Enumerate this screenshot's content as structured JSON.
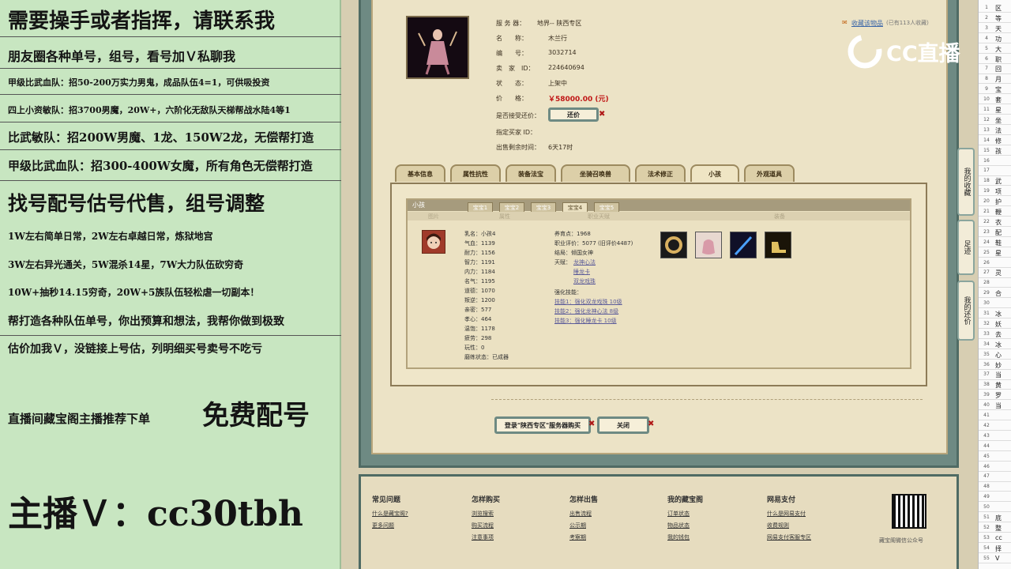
{
  "stream_overlay": {
    "lines": [
      "需要操手或者指挥，请联系我",
      "朋友圈各种单号，组号，看号加Ｖ私聊我",
      "甲级比武血队：招50-200万实力男鬼，成品队伍4=1，可供吸投资",
      "四上小资敏队：招3700男魔，20W+，六阶化无敌队天梯帮战水陆4等1",
      "比武敏队：招200W男魔、1龙、150W2龙，无偿帮打造",
      "甲级比武血队：招300-400W女魔，所有角色无偿帮打造",
      "找号配号估号代售，组号调整",
      "1W左右简单日常，2W左右卓越日常，炼狱地宫",
      "3W左右异光通关，5W混杀14星，7W大力队伍砍穷奇",
      "10W+抽秒14.15穷奇，20W+5族队伍轻松虐一切副本！",
      "帮打造各种队伍单号，你出预算和想法，我帮你做到极致",
      "估价加我Ｖ，没链接上号估，列明细买号卖号不吃亏",
      "直播间藏宝阁主播推荐下单",
      "免费配号",
      "主播Ｖ：cc30tbh"
    ],
    "brand": "CC直播"
  },
  "listing": {
    "server_label": "服 务 器：",
    "server_value": "地界-- 陕西专区",
    "name_label": "名　　称：",
    "name_value": "木兰行",
    "id_label": "编　　号：",
    "id_value": "3032714",
    "seller_label": "卖　家　ID：",
    "seller_value": "224640694",
    "status_label": "状　　态：",
    "status_value": "上架中",
    "price_label": "价　　格：",
    "price_value": "￥58000.00 (元)",
    "counter_label": "是否接受还价：",
    "counter_button": "还价",
    "buyer_label": "指定买家 ID：",
    "remaining_label": "出售剩余时间：",
    "remaining_value": "6天17时",
    "fav_link": "收藏该物品",
    "fav_count": "(已有113人收藏)"
  },
  "tabs": [
    "基本信息",
    "属性抗性",
    "装备法宝",
    "坐骑召唤兽",
    "法术修正",
    "小孩",
    "外观道具"
  ],
  "child_panel": {
    "header": "小孩",
    "subtabs": [
      "宝宝1",
      "宝宝2",
      "宝宝3",
      "宝宝4",
      "宝宝5"
    ],
    "col_headers": [
      "图片",
      "属性",
      "职业天赋",
      "装备"
    ],
    "attrs": [
      "乳名：小孩4",
      "气血：1139",
      "耐力：1156",
      "智力：1191",
      "内力：1184",
      "名气：1195",
      "道德：1070",
      "叛逆：1200",
      "亲密：577",
      "孝心：464",
      "温饱：1178",
      "疲劳：298",
      "玩性：0",
      "磨练状态：已成器"
    ],
    "career": [
      "养育点：1968",
      "职业评价：5077 (旧评价4487)",
      "结局：倾国女神",
      "天赋："
    ],
    "talents": [
      "龙神心法",
      "睡龙卡",
      "双龙戏珠"
    ],
    "skill_title": "强化技能：",
    "skills": [
      "技能1：强化双龙戏珠 10级",
      "技能2：强化龙神心法 8级",
      "技能3：强化睡龙卡 10级"
    ]
  },
  "actions": {
    "buy": "登录\"陕西专区\"服务器购买",
    "close": "关闭"
  },
  "side_buttons": [
    "我的收藏",
    "足迹",
    "我的还价"
  ],
  "footer": {
    "cols": [
      {
        "title": "常见问题",
        "links": [
          "什么是藏宝阁?",
          "更多问题"
        ]
      },
      {
        "title": "怎样购买",
        "links": [
          "浏览搜索",
          "购买流程",
          "注意事项"
        ]
      },
      {
        "title": "怎样出售",
        "links": [
          "出售流程",
          "公示期",
          "考察期"
        ]
      },
      {
        "title": "我的藏宝阁",
        "links": [
          "订单状态",
          "物品状态",
          "我的钱包"
        ]
      },
      {
        "title": "网易支付",
        "links": [
          "什么是网易支付",
          "收费规则",
          "网易支付客服专区"
        ]
      }
    ],
    "qr_caption": "藏宝阁微信公众号"
  },
  "sheet": {
    "rows": [
      {
        "n": "1",
        "t": "区"
      },
      {
        "n": "2",
        "t": "等"
      },
      {
        "n": "3",
        "t": "天"
      },
      {
        "n": "4",
        "t": "功"
      },
      {
        "n": "5",
        "t": "大"
      },
      {
        "n": "6",
        "t": "职"
      },
      {
        "n": "7",
        "t": "回"
      },
      {
        "n": "8",
        "t": "月"
      },
      {
        "n": "9",
        "t": "宝"
      },
      {
        "n": "10",
        "t": "套"
      },
      {
        "n": "11",
        "t": "星"
      },
      {
        "n": "12",
        "t": "坐"
      },
      {
        "n": "13",
        "t": "法"
      },
      {
        "n": "14",
        "t": "修"
      },
      {
        "n": "15",
        "t": "孩"
      },
      {
        "n": "16",
        "t": ""
      },
      {
        "n": "17",
        "t": ""
      },
      {
        "n": "18",
        "t": "武"
      },
      {
        "n": "19",
        "t": "项"
      },
      {
        "n": "20",
        "t": "护"
      },
      {
        "n": "21",
        "t": "鞭"
      },
      {
        "n": "22",
        "t": "衣"
      },
      {
        "n": "23",
        "t": "配"
      },
      {
        "n": "24",
        "t": "鞋"
      },
      {
        "n": "25",
        "t": "星"
      },
      {
        "n": "26",
        "t": ""
      },
      {
        "n": "27",
        "t": "灵"
      },
      {
        "n": "28",
        "t": ""
      },
      {
        "n": "29",
        "t": "合"
      },
      {
        "n": "30",
        "t": ""
      },
      {
        "n": "31",
        "t": "冰"
      },
      {
        "n": "32",
        "t": "妖"
      },
      {
        "n": "33",
        "t": "去"
      },
      {
        "n": "34",
        "t": "冰"
      },
      {
        "n": "35",
        "t": "心"
      },
      {
        "n": "36",
        "t": "妙"
      },
      {
        "n": "37",
        "t": "当"
      },
      {
        "n": "38",
        "t": "黄"
      },
      {
        "n": "39",
        "t": "罗"
      },
      {
        "n": "40",
        "t": "当"
      },
      {
        "n": "41",
        "t": ""
      },
      {
        "n": "42",
        "t": ""
      },
      {
        "n": "43",
        "t": ""
      },
      {
        "n": "44",
        "t": ""
      },
      {
        "n": "45",
        "t": ""
      },
      {
        "n": "46",
        "t": ""
      },
      {
        "n": "47",
        "t": ""
      },
      {
        "n": "48",
        "t": ""
      },
      {
        "n": "49",
        "t": ""
      },
      {
        "n": "50",
        "t": ""
      },
      {
        "n": "51",
        "t": "底"
      },
      {
        "n": "52",
        "t": "整"
      },
      {
        "n": "53",
        "t": "cc"
      },
      {
        "n": "54",
        "t": "择"
      },
      {
        "n": "55",
        "t": "V"
      }
    ]
  }
}
